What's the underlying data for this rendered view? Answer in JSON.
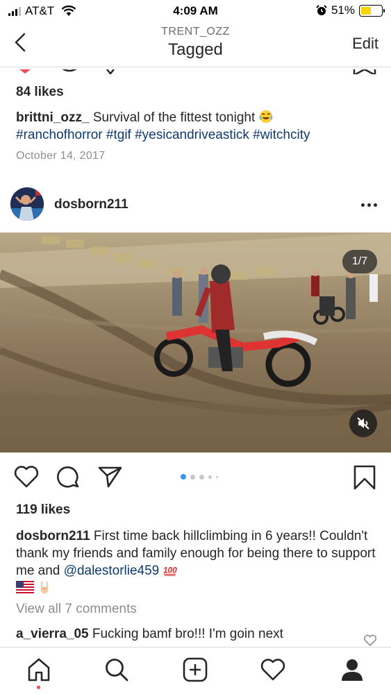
{
  "status_bar": {
    "carrier": "AT&T",
    "time": "4:09 AM",
    "battery": "51%",
    "battery_level": 0.51
  },
  "header": {
    "subtitle": "TRENT_OZZ",
    "title": "Tagged",
    "edit_label": "Edit"
  },
  "prev_post": {
    "likes": "84 likes",
    "caption_user": "brittni_ozz_",
    "caption_text": " Survival of the fittest tonight ",
    "caption_emoji": "joy-emoji",
    "hashtags": [
      "#ranchofhorror",
      "#tgif",
      "#yesicandriveastick",
      "#witchcity"
    ],
    "date": "October 14, 2017"
  },
  "post": {
    "username": "dosborn211",
    "media_counter": "1/7",
    "carousel_dots": 5,
    "likes": "119 likes",
    "caption_user": "dosborn211",
    "caption_text": " First time back hillclimbing in 6 years!! Couldn't thank my friends and family enough for being there to support me and ",
    "mention": "@dalestorlie459",
    "caption_emojis": [
      "hundred-points-emoji",
      "us-flag-emoji",
      "sign-of-horns-emoji"
    ],
    "view_comments": "View all 7 comments",
    "comment_user": "a_vierra_05",
    "comment_text": " Fucking bamf bro!!! I'm goin next"
  },
  "tabs": [
    "home-icon",
    "search-icon",
    "new-post-icon",
    "activity-icon",
    "profile-icon"
  ],
  "colors": {
    "link": "#0e3a6e",
    "accent_blue": "#3897f0",
    "notification_red": "#ed4956"
  }
}
